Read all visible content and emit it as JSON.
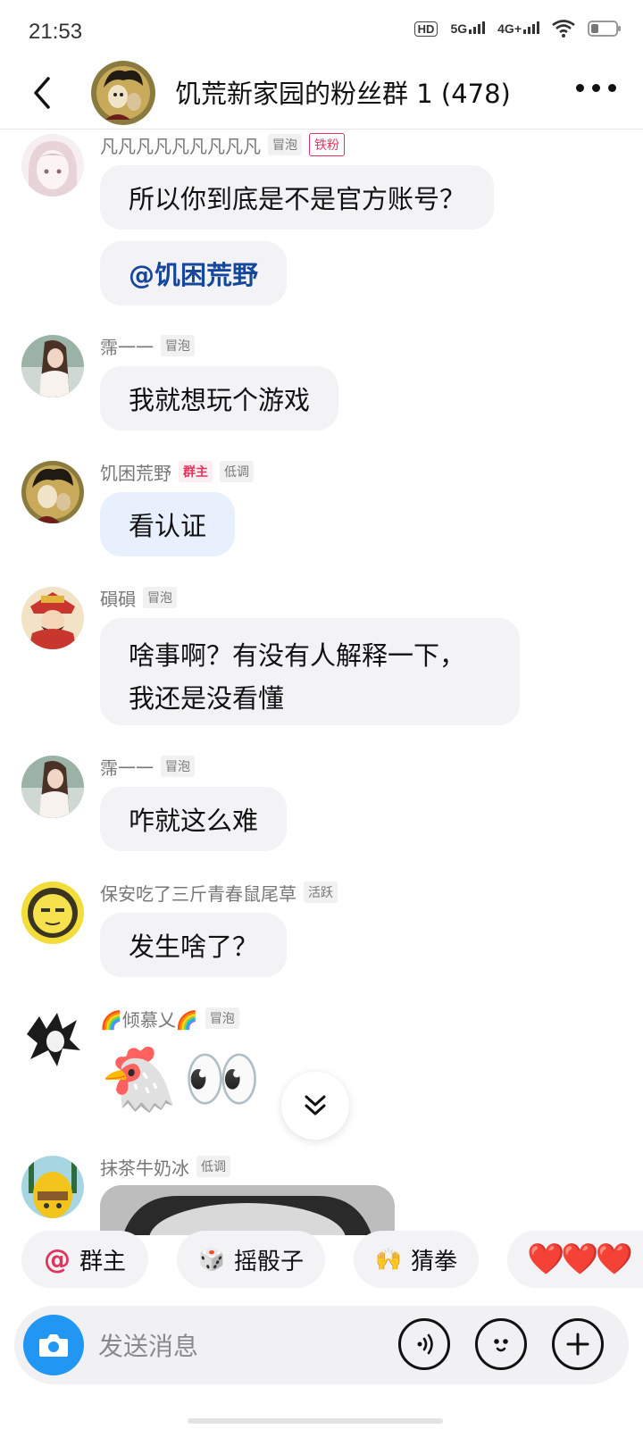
{
  "status": {
    "time": "21:53",
    "hd": "HD",
    "net1": "5G",
    "net2": "4G+"
  },
  "header": {
    "title": "饥荒新家园的粉丝群 1 (478)",
    "back_icon": "chevron-left-icon",
    "more_icon": "more-dots-icon"
  },
  "messages": [
    {
      "name": "凡凡凡凡凡凡凡凡凡",
      "tags": [
        "冒泡",
        "铁粉"
      ],
      "bubbles": [
        "所以你到底是不是官方账号？",
        "@饥困荒野"
      ]
    },
    {
      "name": "霈一一",
      "tags": [
        "冒泡"
      ],
      "bubbles": [
        "我就想玩个游戏"
      ]
    },
    {
      "name": "饥困荒野",
      "tags": [
        "群主",
        "低调"
      ],
      "bubbles": [
        "看认证"
      ]
    },
    {
      "name": "磒磒",
      "tags": [
        "冒泡"
      ],
      "bubbles": [
        "啥事啊？有没有人解释一下，",
        "我还是没看懂"
      ]
    },
    {
      "name": "霈一一",
      "tags": [
        "冒泡"
      ],
      "bubbles": [
        "咋就这么难"
      ]
    },
    {
      "name": "保安吃了三斤青春鼠尾草",
      "tags": [
        "活跃"
      ],
      "bubbles": [
        "发生啥了？"
      ]
    },
    {
      "name": "🌈倾慕乂🌈",
      "tags": [
        "冒泡"
      ],
      "emoji": "🐔👀"
    },
    {
      "name": "抹茶牛奶冰",
      "tags": [
        "低调"
      ]
    }
  ],
  "quick_actions": [
    {
      "icon": "@",
      "label": "群主"
    },
    {
      "icon": "🎲",
      "label": "摇骰子"
    },
    {
      "icon": "🙌",
      "label": "猜拳"
    },
    {
      "icon": "❤️❤️❤️",
      "label": ""
    }
  ],
  "input": {
    "placeholder": "发送消息"
  },
  "colors": {
    "accent": "#2196f3",
    "mention": "#17479c",
    "owner_tag": "#e2335e",
    "bubble": "#f3f3f5",
    "bubble_owner": "#e8f0fe"
  }
}
